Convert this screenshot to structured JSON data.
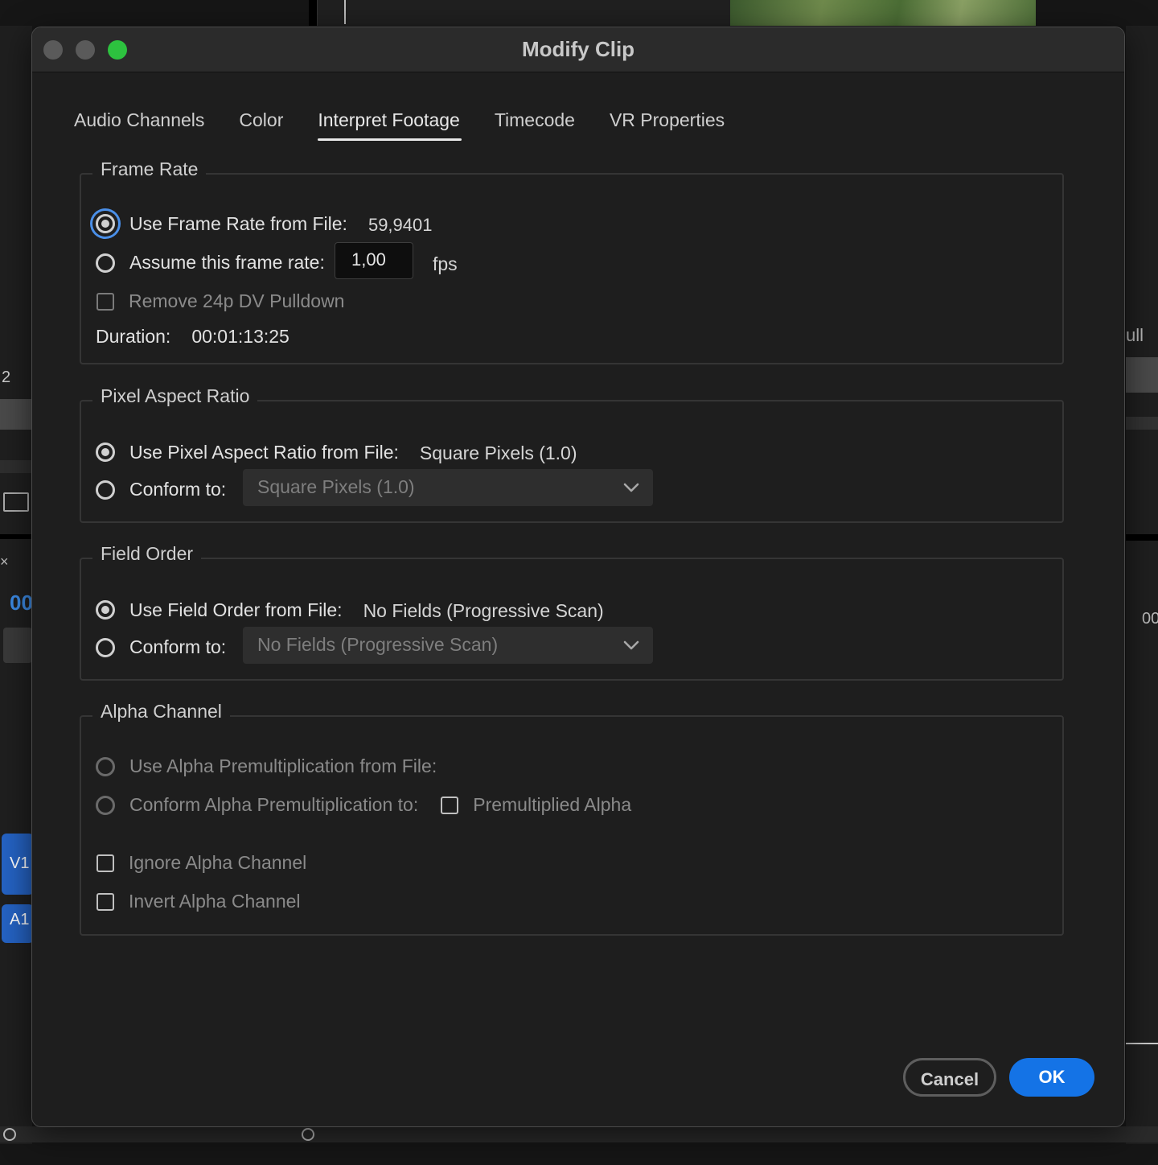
{
  "background": {
    "left_number": "2",
    "left_close": "×",
    "left_timecode": "00",
    "track_v1": "V1",
    "track_a1": "A1",
    "right_label": "ull",
    "right_timecode": "00"
  },
  "dialog": {
    "title": "Modify Clip",
    "tabs": [
      {
        "label": "Audio Channels"
      },
      {
        "label": "Color"
      },
      {
        "label": "Interpret Footage",
        "active": true
      },
      {
        "label": "Timecode"
      },
      {
        "label": "VR Properties"
      }
    ],
    "frame_rate": {
      "title": "Frame Rate",
      "use_from_file_label": "Use Frame Rate from File:",
      "use_from_file_value": "59,9401",
      "assume_label": "Assume this frame rate:",
      "assume_value": "1,00",
      "fps_unit": "fps",
      "pulldown_label": "Remove 24p DV Pulldown",
      "duration_label": "Duration:",
      "duration_value": "00:01:13:25"
    },
    "pixel_aspect": {
      "title": "Pixel Aspect Ratio",
      "use_from_file_label": "Use Pixel Aspect Ratio from File:",
      "use_from_file_value": "Square Pixels (1.0)",
      "conform_label": "Conform to:",
      "conform_selected": "Square Pixels (1.0)"
    },
    "field_order": {
      "title": "Field Order",
      "use_from_file_label": "Use Field Order from File:",
      "use_from_file_value": "No Fields (Progressive Scan)",
      "conform_label": "Conform to:",
      "conform_selected": "No Fields (Progressive Scan)"
    },
    "alpha": {
      "title": "Alpha Channel",
      "use_premult_label": "Use Alpha Premultiplication from File:",
      "conform_premult_label": "Conform Alpha Premultiplication to:",
      "premultiplied_label": "Premultiplied Alpha",
      "ignore_label": "Ignore Alpha Channel",
      "invert_label": "Invert Alpha Channel"
    },
    "buttons": {
      "cancel": "Cancel",
      "ok": "OK"
    }
  },
  "colors": {
    "accent": "#1473e6",
    "focus_ring": "#4a8fe8",
    "traffic_green": "#2dc23f",
    "track_blue": "#2563c4"
  }
}
